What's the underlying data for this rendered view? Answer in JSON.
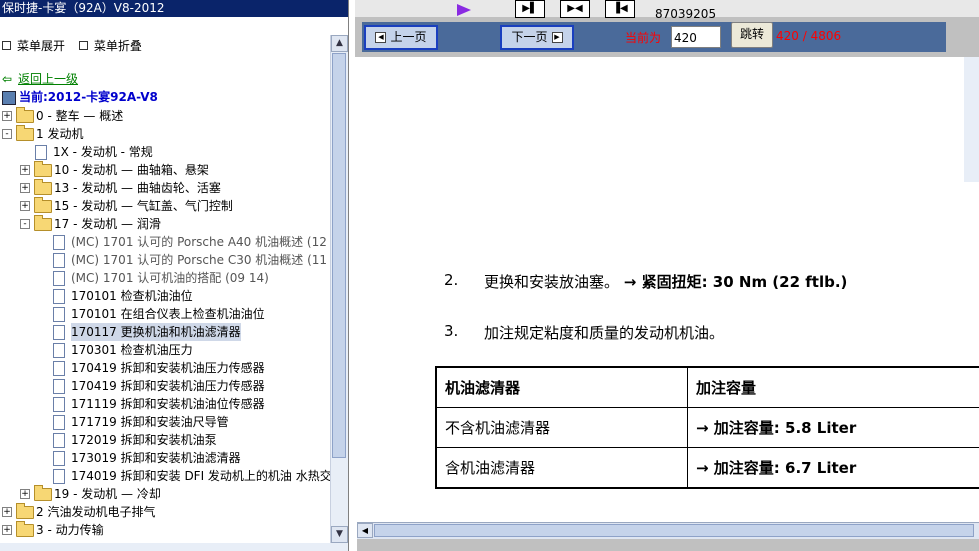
{
  "left_panel": {
    "title": "保时捷-卡宴（92A）V8-2012",
    "expand_all": "菜单展开",
    "collapse_all": "菜单折叠",
    "back": "返回上一级",
    "current": "当前:2012-卡宴92A-V8",
    "tree": [
      {
        "label": "0 - 整车 — 概述",
        "type": "folder",
        "expander": "+",
        "depth": 0
      },
      {
        "label": "1 发动机",
        "type": "folder",
        "expander": "-",
        "depth": 0
      },
      {
        "label": "1X - 发动机 - 常规",
        "type": "doc",
        "expander": "",
        "depth": 1
      },
      {
        "label": "10 - 发动机 — 曲轴箱、悬架",
        "type": "folder",
        "expander": "+",
        "depth": 1
      },
      {
        "label": "13 - 发动机 — 曲轴齿轮、活塞",
        "type": "folder",
        "expander": "+",
        "depth": 1
      },
      {
        "label": "15 - 发动机 — 气缸盖、气门控制",
        "type": "folder",
        "expander": "+",
        "depth": 1
      },
      {
        "label": "17 - 发动机 — 润滑",
        "type": "folder",
        "expander": "-",
        "depth": 1
      },
      {
        "label": "(MC) 1701 认可的 Porsche A40 机油概述 (12",
        "type": "doc",
        "expander": "",
        "depth": 2,
        "style": "pdf"
      },
      {
        "label": "(MC) 1701 认可的 Porsche C30 机油概述 (11",
        "type": "doc",
        "expander": "",
        "depth": 2,
        "style": "pdf"
      },
      {
        "label": "(MC) 1701 认可机油的搭配 (09 14)",
        "type": "doc",
        "expander": "",
        "depth": 2,
        "style": "pdf"
      },
      {
        "label": "170101 检查机油油位",
        "type": "doc",
        "expander": "",
        "depth": 2
      },
      {
        "label": "170101 在组合仪表上检查机油油位",
        "type": "doc",
        "expander": "",
        "depth": 2
      },
      {
        "label": "170117 更换机油和机油滤清器",
        "type": "doc",
        "expander": "",
        "depth": 2,
        "selected": true
      },
      {
        "label": "170301 检查机油压力",
        "type": "doc",
        "expander": "",
        "depth": 2
      },
      {
        "label": "170419 拆卸和安装机油压力传感器",
        "type": "doc",
        "expander": "",
        "depth": 2
      },
      {
        "label": "170419 拆卸和安装机油压力传感器",
        "type": "doc",
        "expander": "",
        "depth": 2
      },
      {
        "label": "171119 拆卸和安装机油油位传感器",
        "type": "doc",
        "expander": "",
        "depth": 2
      },
      {
        "label": "171719 拆卸和安装油尺导管",
        "type": "doc",
        "expander": "",
        "depth": 2
      },
      {
        "label": "172019 拆卸和安装机油泵",
        "type": "doc",
        "expander": "",
        "depth": 2
      },
      {
        "label": "173019 拆卸和安装机油滤清器",
        "type": "doc",
        "expander": "",
        "depth": 2
      },
      {
        "label": "174019 拆卸和安装 DFI 发动机上的机油 水热交",
        "type": "doc",
        "expander": "",
        "depth": 2
      },
      {
        "label": "19 - 发动机 — 冷却",
        "type": "folder",
        "expander": "+",
        "depth": 1
      },
      {
        "label": "2 汽油发动机电子排气",
        "type": "folder",
        "expander": "+",
        "depth": 0
      },
      {
        "label": "3 - 动力传输",
        "type": "folder",
        "expander": "+",
        "depth": 0
      }
    ]
  },
  "toolbar": {
    "phone": "87039205",
    "prev": "上一页",
    "next": "下一页",
    "current_label": "当前为",
    "page_value": "420",
    "jump": "跳转",
    "page_total": "420 / 4806"
  },
  "document": {
    "steps": [
      {
        "num": "2.",
        "text": "更换和安装放油塞。",
        "bold": "→ 紧固扭矩: 30 Nm (22 ftlb.)"
      },
      {
        "num": "3.",
        "text": "加注规定粘度和质量的发动机机油。",
        "bold": ""
      }
    ],
    "table": {
      "headers": [
        "机油滤清器",
        "加注容量"
      ],
      "rows": [
        [
          "不含机油滤清器",
          "→ 加注容量: 5.8 Liter"
        ],
        [
          "含机油滤清器",
          "→ 加注容量: 6.7 Liter"
        ]
      ]
    }
  },
  "colors": {
    "title_bar": "#0a246a",
    "accent_red": "#ff0000",
    "nav_border": "#1a3fbf"
  }
}
